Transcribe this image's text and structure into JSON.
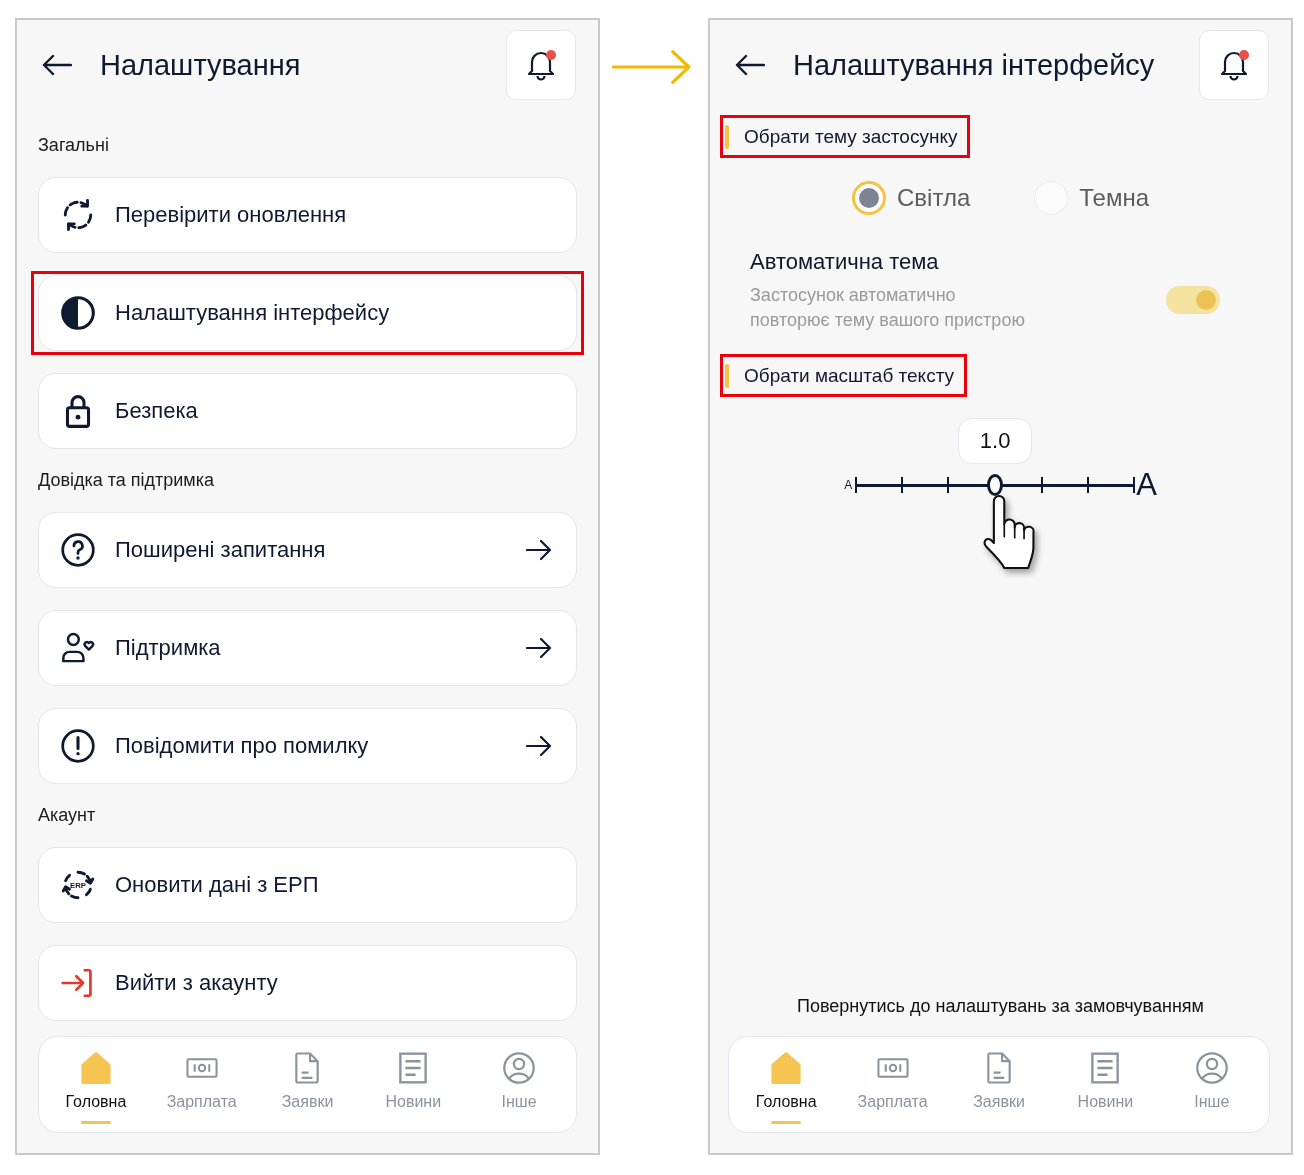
{
  "screens": [
    {
      "kind": "settings_list",
      "header": {
        "title": "Налаштування",
        "has_notification": true
      },
      "sections": [
        {
          "title": "Загальні",
          "items": [
            {
              "label": "Перевірити оновлення",
              "has_arrow": false,
              "highlighted": false
            },
            {
              "label": "Налаштування інтерфейсу",
              "has_arrow": false,
              "highlighted": true
            },
            {
              "label": "Безпека",
              "has_arrow": false,
              "highlighted": false
            }
          ]
        },
        {
          "title": "Довідка та підтримка",
          "items": [
            {
              "label": "Поширені запитання",
              "has_arrow": true,
              "highlighted": false
            },
            {
              "label": "Підтримка",
              "has_arrow": true,
              "highlighted": false
            },
            {
              "label": "Повідомити про помилку",
              "has_arrow": true,
              "highlighted": false
            }
          ]
        },
        {
          "title": "Акаунт",
          "items": [
            {
              "label": "Оновити дані з ЕРП",
              "icon_text": "ERP",
              "has_arrow": false,
              "highlighted": false
            },
            {
              "label": "Вийти з акаунту",
              "has_arrow": false,
              "highlighted": false
            }
          ]
        }
      ],
      "nav": [
        {
          "label": "Головна",
          "selected": true
        },
        {
          "label": "Зарплата",
          "selected": false
        },
        {
          "label": "Заявки",
          "selected": false
        },
        {
          "label": "Новини",
          "selected": false
        },
        {
          "label": "Інше",
          "selected": false
        }
      ]
    },
    {
      "kind": "interface_settings",
      "header": {
        "title": "Налаштування інтерфейсу",
        "has_notification": true
      },
      "theme_section": {
        "title": "Обрати тему застосунку",
        "highlighted": true,
        "options": [
          {
            "label": "Світла",
            "selected": true
          },
          {
            "label": "Темна",
            "selected": false
          }
        ],
        "auto_theme": {
          "title": "Автоматична тема",
          "description": "Застосунок автоматично\nповторює тему вашого пристрою",
          "on": true,
          "disabled": true
        }
      },
      "scale_section": {
        "title": "Обрати масштаб тексту",
        "highlighted": true,
        "slider": {
          "value": "1.0",
          "level": 0.5,
          "min_label": "A",
          "max_label": "A"
        }
      },
      "reset_link": "Повернутись до налаштувань за замовчуванням",
      "nav": [
        {
          "label": "Головна",
          "selected": true
        },
        {
          "label": "Зарплата",
          "selected": false
        },
        {
          "label": "Заявки",
          "selected": false
        },
        {
          "label": "Новини",
          "selected": false
        },
        {
          "label": "Інше",
          "selected": false
        }
      ]
    }
  ]
}
